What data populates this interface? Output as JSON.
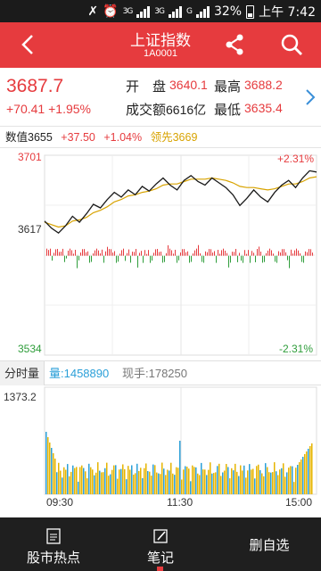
{
  "status": {
    "signal1": "3G",
    "signal2": "3G",
    "signal3": "G",
    "battery": "32%",
    "time": "上午 7:42"
  },
  "header": {
    "title": "上证指数",
    "code": "1A0001"
  },
  "quote": {
    "price": "3687.7",
    "change": "+70.41",
    "change_pct": "+1.95%",
    "open_label": "开　盘",
    "open_value": "3640.1",
    "high_label": "最高",
    "high_value": "3688.2",
    "turnover_label": "成交额",
    "turnover_value": "6616亿",
    "low_label": "最低",
    "low_value": "3635.4"
  },
  "indicator": {
    "value_label": "数值3655",
    "change": "+37.50",
    "pct": "+1.04%",
    "leader": "领先3669"
  },
  "chart_labels": {
    "y_top": "3701",
    "y_mid": "3617",
    "y_bottom": "3534",
    "pct_top": "+2.31%",
    "pct_bottom": "-2.31%",
    "vol_max": "1373.2"
  },
  "volume_tabs": {
    "tab": "分时量",
    "volume": "量:1458890",
    "current": "现手:178250"
  },
  "time_axis": [
    "09:30",
    "11:30",
    "15:00"
  ],
  "nav": {
    "hot": "股市热点",
    "notes": "笔记",
    "delete": "删自选"
  },
  "colors": {
    "brand_red": "#e63b3e",
    "up": "#e63b3e",
    "down": "#2e9d3a",
    "average_line": "#d8a300",
    "volume_blue": "#2a9fd8"
  },
  "chart_data": {
    "type": "line",
    "x_range": [
      "09:30",
      "15:00"
    ],
    "ylim": [
      3534,
      3701
    ],
    "reference": 3617,
    "series": [
      {
        "values": [
          3646,
          3640,
          3636,
          3642,
          3650,
          3645,
          3652,
          3660,
          3657,
          3664,
          3670,
          3666,
          3672,
          3668,
          3675,
          3671,
          3677,
          3682,
          3676,
          3672,
          3680,
          3684,
          3679,
          3676,
          3682,
          3678,
          3674,
          3668,
          3659,
          3665,
          3672,
          3666,
          3662,
          3670,
          3676,
          3680,
          3674,
          3682,
          3688,
          3687
        ]
      },
      {
        "values": [
          3645,
          3643,
          3641,
          3642,
          3646,
          3647,
          3649,
          3653,
          3655,
          3658,
          3662,
          3664,
          3667,
          3668,
          3670,
          3671,
          3673,
          3676,
          3677,
          3677,
          3679,
          3681,
          3681,
          3681,
          3682,
          3681,
          3680,
          3678,
          3675,
          3674,
          3674,
          3673,
          3672,
          3673,
          3675,
          3677,
          3677,
          3679,
          3682,
          3683
        ]
      }
    ],
    "volume_max": 1373.2
  }
}
